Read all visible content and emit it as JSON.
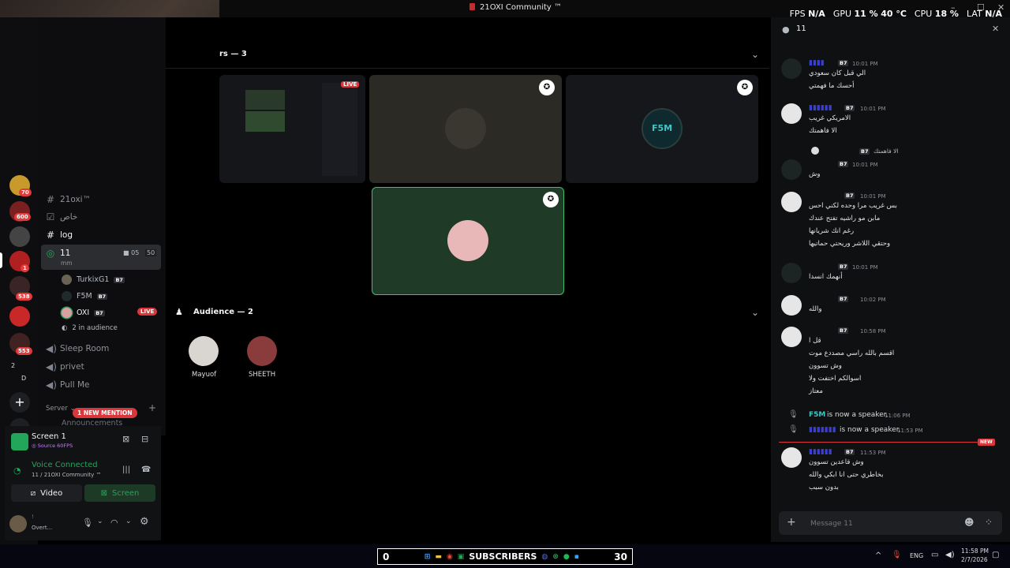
{
  "window": {
    "title": "21OXI Community ™"
  },
  "overlay": {
    "fps_label": "FPS",
    "fps_value": "N/A",
    "gpu_label": "GPU",
    "gpu_value": "11 %",
    "gpu_temp": "40 °C",
    "cpu_label": "CPU",
    "cpu_value": "18 %",
    "lat_label": "LAT",
    "lat_value": "N/A"
  },
  "rail": {
    "badges": [
      "70",
      "600",
      "1",
      "538",
      "553"
    ],
    "group_text": [
      "2",
      "D"
    ]
  },
  "channels": {
    "items": [
      "21oxi™",
      "خاص",
      "log"
    ],
    "voice_channel": {
      "name": "11",
      "subtitle": "mm",
      "cam_count": "05",
      "limit": "50"
    },
    "voice_users": [
      {
        "name": "TurkixG1",
        "tag": "B7"
      },
      {
        "name": "F5M",
        "tag": "B7"
      },
      {
        "name": "OXI",
        "tag": "B7",
        "live": "LIVE"
      }
    ],
    "audience_count": "2 in audience",
    "more": [
      "Sleep Room",
      "privet",
      "Pull Me"
    ],
    "category": "Server",
    "mention": "1 NEW MENTION",
    "announcements": "Announcements"
  },
  "panel": {
    "stream_title": "Screen 1",
    "stream_source": "Source 60FPS",
    "voice_status": "Voice Connected",
    "voice_location": "11 / 21OXI Community ™",
    "video_label": "Video",
    "screen_label": "Screen",
    "user_name": "Overt...",
    "user_tag": "!"
  },
  "stage": {
    "speakers_header": "rs — 3",
    "live_badge": "LIVE",
    "audience_header": "Audience — 2",
    "audience": [
      {
        "name": "Mayuof"
      },
      {
        "name": "SHEETH"
      }
    ],
    "f5m_logo": "F5M"
  },
  "chat": {
    "header_title": "11",
    "messages": [
      {
        "tag": "B7",
        "time": "10:01 PM",
        "lines": [
          "الي قبل كان سعودي",
          "أحسك ما فهمتي"
        ]
      },
      {
        "tag": "B7",
        "time": "10:01 PM",
        "lines": [
          "الامريكي غريب",
          "الا فاهمتك"
        ]
      },
      {
        "reply_tag": "B7",
        "reply_text": "الا فاهمتك",
        "tag": "B7",
        "time": "10:01 PM",
        "lines": [
          "وش"
        ]
      },
      {
        "tag": "B7",
        "time": "10:01 PM",
        "lines": [
          "بس غريب مرا وحده لكني احس",
          "مابن مو راشيه تفتح عندك",
          "رغم انك شريانها",
          "وحتقي اللاشر وريحتي حماتيها"
        ]
      },
      {
        "tag": "B7",
        "time": "10:01 PM",
        "lines": [
          "أنهمك انسدا"
        ]
      },
      {
        "tag": "B7",
        "time": "10:02 PM",
        "lines": [
          "والله"
        ]
      },
      {
        "tag": "B7",
        "time": "10:58 PM",
        "lines": [
          "قل ا",
          "اقسم بالله راسي مصددع موت",
          "وش تسوون",
          "اسوالكم اختفت ولا",
          "معتاز"
        ]
      }
    ],
    "system": [
      {
        "name": "F5M",
        "text": "is now a speaker.",
        "time": "11:06 PM"
      },
      {
        "text": "is now a speaker.",
        "time": "11:53 PM"
      }
    ],
    "new_badge": "NEW",
    "last": {
      "tag": "B7",
      "time": "11:53 PM",
      "lines": [
        "وش قاعدين تسوون",
        "بخاطري حتى انا ابكي والله",
        "بدون سبب"
      ]
    },
    "input_placeholder": "Message 11"
  },
  "taskbar": {
    "left_count": "0",
    "subscribers_label": "SUBSCRIBERS",
    "right_count": "30",
    "lang": "ENG",
    "time": "11:58 PM",
    "date": "2/7/2026"
  },
  "colors": {
    "accent_green": "#23a55a",
    "live_red": "#da373c",
    "mention_red": "#e23b3b",
    "speaker_name": "#3a3fd0",
    "f5m_cyan": "#3ec6c6"
  }
}
